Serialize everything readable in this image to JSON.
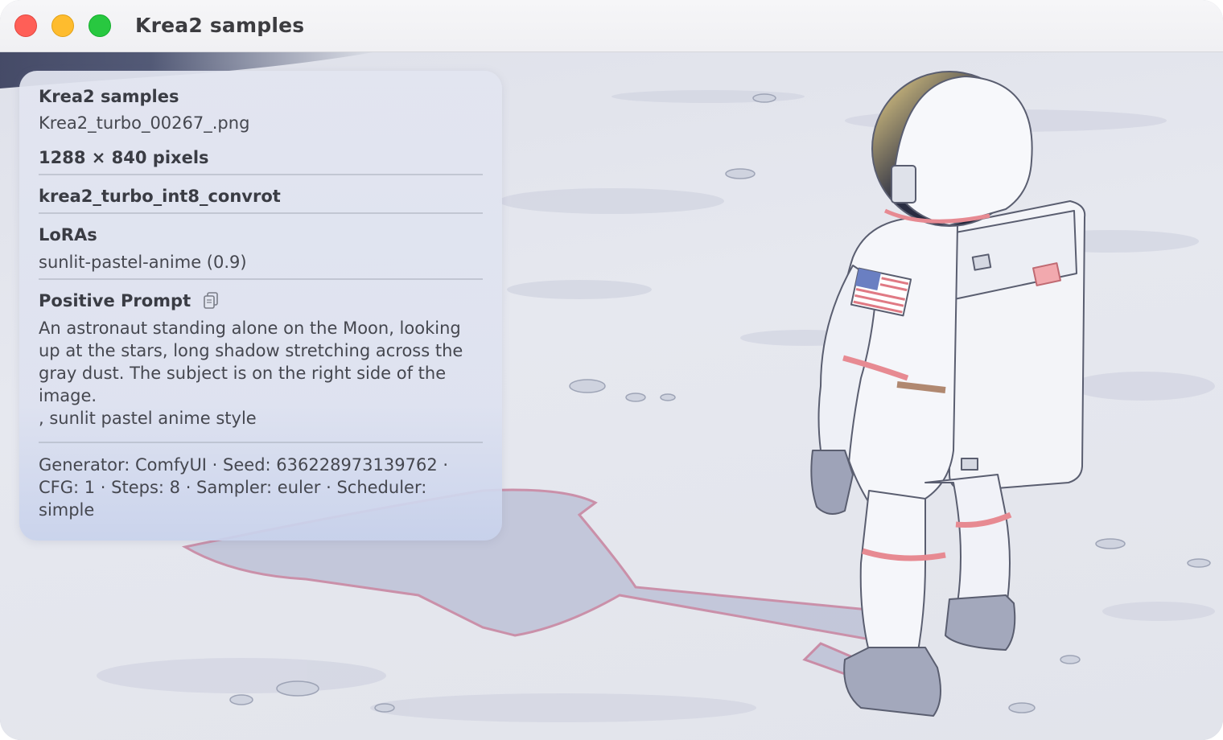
{
  "window": {
    "title": "Krea2 samples"
  },
  "info": {
    "album": "Krea2 samples",
    "filename": "Krea2_turbo_00267_.png",
    "dimensions": "1288 × 840 pixels",
    "model": "krea2_turbo_int8_convrot",
    "loras_heading": "LoRAs",
    "lora_entry": "sunlit-pastel-anime (0.9)",
    "prompt_heading": "Positive Prompt",
    "prompt_text": "An astronaut standing alone on the Moon, looking\nup at the stars, long shadow stretching across the\ngray dust. The subject is on the right side of the\nimage.\n, sunlit pastel anime style",
    "metadata": "Generator: ComfyUI · Seed: 636228973139762 ·\nCFG: 1 · Steps: 8 · Sampler: euler · Scheduler:\nsimple"
  },
  "icons": {
    "copy": "copy-icon"
  },
  "colors": {
    "close": "#ff5f57",
    "minimize": "#febc2e",
    "maximize": "#28c840"
  }
}
